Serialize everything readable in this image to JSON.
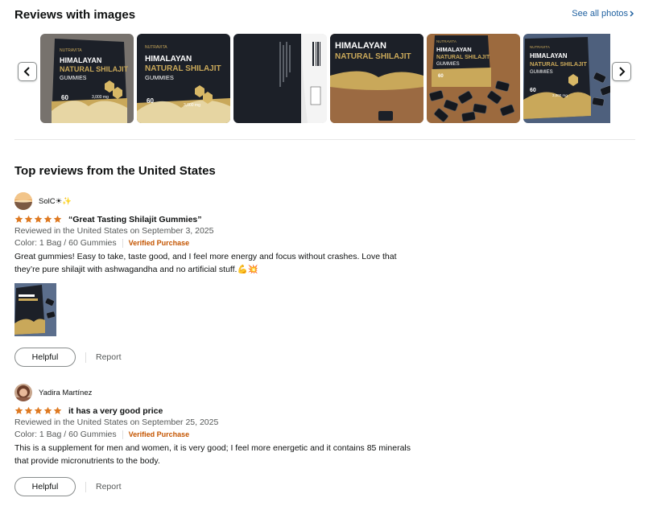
{
  "images_section": {
    "title": "Reviews with images",
    "see_all": "See all photos",
    "see_all_icon": "chevron-right-icon",
    "prev_icon": "chevron-left-icon",
    "next_icon": "chevron-right-icon",
    "thumbnails": [
      {
        "brand": "NUTRAVITA",
        "line1": "HIMALAYAN",
        "line2": "NATURAL SHILAJIT",
        "line3": "GUMMIES",
        "count": "60",
        "dose": "3,000 mg"
      },
      {
        "brand": "NUTRAVITA",
        "line1": "HIMALAYAN",
        "line2": "NATURAL SHILAJIT",
        "line3": "GUMMIES",
        "count": "60",
        "dose": "3,000 mg"
      },
      {
        "brand": "",
        "line1": "",
        "line2": "",
        "line3": "",
        "count": "",
        "dose": ""
      },
      {
        "brand": "",
        "line1": "HIMALAYAN",
        "line2": "NATURAL SHILAJIT",
        "line3": "",
        "count": "",
        "dose": ""
      },
      {
        "brand": "NUTRAVITA",
        "line1": "HIMALAYAN",
        "line2": "NATURAL SHILAJIT",
        "line3": "GUMMIES",
        "count": "60",
        "dose": ""
      },
      {
        "brand": "NUTRAVITA",
        "line1": "HIMALAYAN",
        "line2": "NATURAL SHILAJIT",
        "line3": "GUMMIES",
        "count": "60",
        "dose": "3,000 mg"
      }
    ]
  },
  "reviews_section": {
    "title": "Top reviews from the United States",
    "reviews": [
      {
        "reviewer": "SolC☀✨",
        "rating": 5,
        "title": "“Great Tasting Shilajit Gummies”",
        "date": "Reviewed in the United States on September 3, 2025",
        "color": "Color: 1 Bag / 60 Gummies",
        "verified": "Verified Purchase",
        "body": "Great gummies! Easy to take, taste good, and I feel more energy and focus without crashes. Love that they’re pure shilajit with ashwagandha and no artificial stuff.💪💥",
        "helpful": "Helpful",
        "report": "Report"
      },
      {
        "reviewer": "Yadira Martínez",
        "rating": 5,
        "title": "it has a very good price",
        "date": "Reviewed in the United States on September 25, 2025",
        "color": "Color: 1 Bag / 60 Gummies",
        "verified": "Verified Purchase",
        "body": "This is a supplement for men and women, it is very good; I feel more energetic and it contains 85 minerals that provide micronutrients to the body.",
        "helpful": "Helpful",
        "report": "Report"
      }
    ]
  },
  "colors": {
    "star": "#de7921",
    "link": "#2162a1",
    "verified": "#c45500",
    "bag": "#1c2028",
    "gold": "#c9a85a"
  }
}
